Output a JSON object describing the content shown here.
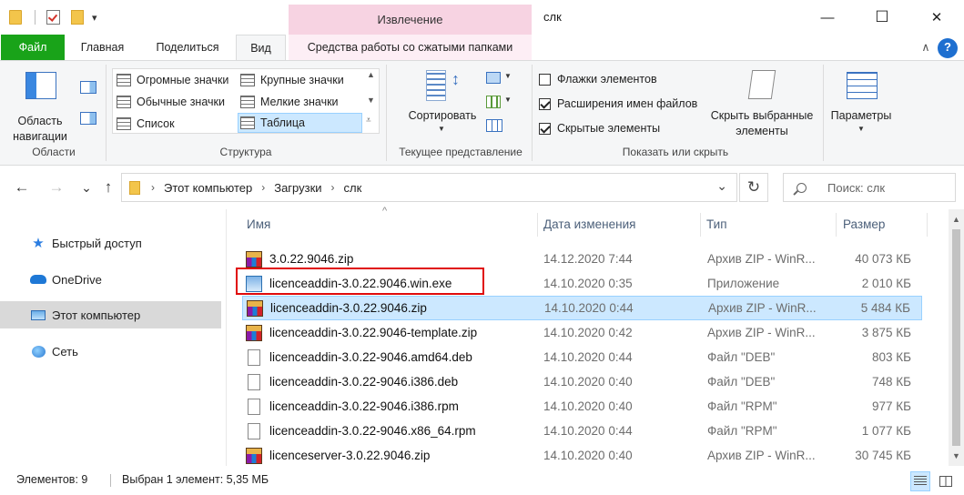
{
  "window": {
    "title": "слк",
    "context_tab": "Извлечение",
    "minimize_glyph": "—",
    "maximize_glyph": "☐",
    "close_glyph": "✕"
  },
  "quick_access": {
    "dropdown_glyph": "▾"
  },
  "ribbon_tabs": {
    "file": "Файл",
    "home": "Главная",
    "share": "Поделиться",
    "view": "Вид",
    "compressed_tools": "Средства работы со сжатыми папками",
    "collapse_glyph": "∧",
    "help_glyph": "?"
  },
  "ribbon": {
    "panes": {
      "nav_pane_line1": "Область",
      "nav_pane_line2": "навигации",
      "group_label": "Области"
    },
    "layout": {
      "items": [
        "Огромные значки",
        "Крупные значки",
        "Обычные значки",
        "Мелкие значки",
        "Список",
        "Таблица"
      ],
      "group_label": "Структура"
    },
    "current_view": {
      "sort_label": "Сортировать",
      "group_label": "Текущее представление"
    },
    "show_hide": {
      "item_checkboxes": "Флажки элементов",
      "file_extensions": "Расширения имен файлов",
      "hidden_items": "Скрытые элементы",
      "hide_selected_line1": "Скрыть выбранные",
      "hide_selected_line2": "элементы",
      "group_label": "Показать или скрыть",
      "checkbox_states": [
        false,
        true,
        true
      ]
    },
    "options_label": "Параметры"
  },
  "address_bar": {
    "back_glyph": "←",
    "forward_glyph": "→",
    "recent_glyph": "⌄",
    "up_glyph": "↑",
    "breadcrumb": [
      "Этот компьютер",
      "Загрузки",
      "слк"
    ],
    "separator_glyph": "›",
    "dropdown_glyph": "⌄",
    "refresh_glyph": "↻",
    "search_placeholder": "Поиск: слк"
  },
  "sidebar": {
    "items": [
      {
        "label": "Быстрый доступ",
        "icon": "star-icon"
      },
      {
        "label": "OneDrive",
        "icon": "cloud-icon"
      },
      {
        "label": "Этот компьютер",
        "icon": "computer-icon"
      },
      {
        "label": "Сеть",
        "icon": "network-icon"
      }
    ]
  },
  "file_list": {
    "columns": {
      "name": "Имя",
      "date": "Дата изменения",
      "type": "Тип",
      "size": "Размер"
    },
    "sort_glyph": "^",
    "rows": [
      {
        "name": "3.0.22.9046.zip",
        "date": "14.12.2020 7:44",
        "type": "Архив ZIP - WinR...",
        "size": "40 073 КБ",
        "icon": "zip"
      },
      {
        "name": "licenceaddin-3.0.22.9046.win.exe",
        "date": "14.10.2020 0:35",
        "type": "Приложение",
        "size": "2 010 КБ",
        "icon": "exe"
      },
      {
        "name": "licenceaddin-3.0.22.9046.zip",
        "date": "14.10.2020 0:44",
        "type": "Архив ZIP - WinR...",
        "size": "5 484 КБ",
        "icon": "zip"
      },
      {
        "name": "licenceaddin-3.0.22.9046-template.zip",
        "date": "14.10.2020 0:42",
        "type": "Архив ZIP - WinR...",
        "size": "3 875 КБ",
        "icon": "zip"
      },
      {
        "name": "licenceaddin-3.0.22-9046.amd64.deb",
        "date": "14.10.2020 0:44",
        "type": "Файл \"DEB\"",
        "size": "803 КБ",
        "icon": "doc"
      },
      {
        "name": "licenceaddin-3.0.22-9046.i386.deb",
        "date": "14.10.2020 0:40",
        "type": "Файл \"DEB\"",
        "size": "748 КБ",
        "icon": "doc"
      },
      {
        "name": "licenceaddin-3.0.22-9046.i386.rpm",
        "date": "14.10.2020 0:40",
        "type": "Файл \"RPM\"",
        "size": "977 КБ",
        "icon": "doc"
      },
      {
        "name": "licenceaddin-3.0.22-9046.x86_64.rpm",
        "date": "14.10.2020 0:44",
        "type": "Файл \"RPM\"",
        "size": "1 077 КБ",
        "icon": "doc"
      },
      {
        "name": "licenceserver-3.0.22.9046.zip",
        "date": "14.10.2020 0:40",
        "type": "Архив ZIP - WinR...",
        "size": "30 745 КБ",
        "icon": "zip"
      }
    ],
    "selected_index": 2,
    "highlighted_index": 1
  },
  "status_bar": {
    "item_count": "Элементов: 9",
    "selection": "Выбран 1 элемент: 5,35 МБ"
  },
  "colors": {
    "file_tab": "#19a319",
    "context_tab": "#f7d3e2",
    "selection": "#cce8ff",
    "highlight_border": "#e00b0b"
  }
}
